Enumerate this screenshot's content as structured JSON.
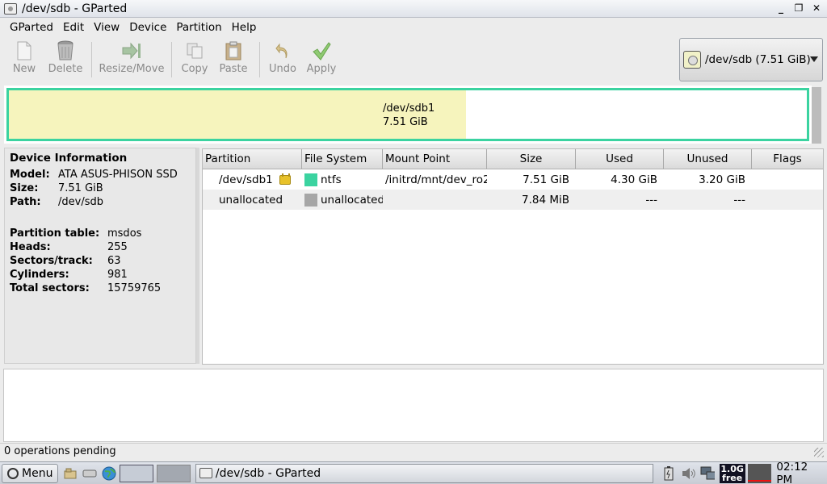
{
  "window": {
    "title": "/dev/sdb - GParted"
  },
  "menubar": [
    "GParted",
    "Edit",
    "View",
    "Device",
    "Partition",
    "Help"
  ],
  "toolbar": {
    "new": "New",
    "delete": "Delete",
    "resize_move": "Resize/Move",
    "copy": "Copy",
    "paste": "Paste",
    "undo": "Undo",
    "apply": "Apply"
  },
  "device_selector": {
    "label": "/dev/sdb  (7.51 GiB)"
  },
  "disk_graph": {
    "partition": "/dev/sdb1",
    "size": "7.51 GiB",
    "used_fraction": 0.573
  },
  "device_info": {
    "heading": "Device Information",
    "model_key": "Model:",
    "model": "ATA ASUS-PHISON SSD",
    "size_key": "Size:",
    "size": "7.51 GiB",
    "path_key": "Path:",
    "path": "/dev/sdb",
    "ptable_key": "Partition table:",
    "ptable": "msdos",
    "heads_key": "Heads:",
    "heads": "255",
    "sectors_key": "Sectors/track:",
    "sectors": "63",
    "cyl_key": "Cylinders:",
    "cyl": "981",
    "total_key": "Total sectors:",
    "total": "15759765"
  },
  "table": {
    "headers": [
      "Partition",
      "File System",
      "Mount Point",
      "Size",
      "Used",
      "Unused",
      "Flags"
    ],
    "rows": [
      {
        "partition": "/dev/sdb1",
        "fs": "ntfs",
        "fs_color": "#3bd3a0",
        "mount": "/initrd/mnt/dev_ro2",
        "size": "7.51 GiB",
        "used": "4.30 GiB",
        "unused": "3.20 GiB",
        "flags": ""
      },
      {
        "partition": "unallocated",
        "fs": "unallocated",
        "fs_color": "#a6a6a6",
        "mount": "",
        "size": "7.84 MiB",
        "used": "---",
        "unused": "---",
        "flags": ""
      }
    ]
  },
  "statusbar": {
    "text": "0 operations pending"
  },
  "taskbar": {
    "menu": "Menu",
    "task": "/dev/sdb - GParted",
    "free_mem_top": "1.0G",
    "free_mem_bottom": "free",
    "clock": "02:12 PM"
  },
  "colors": {
    "ntfs": "#3bd3a0",
    "used_space": "#f6f4bd"
  }
}
